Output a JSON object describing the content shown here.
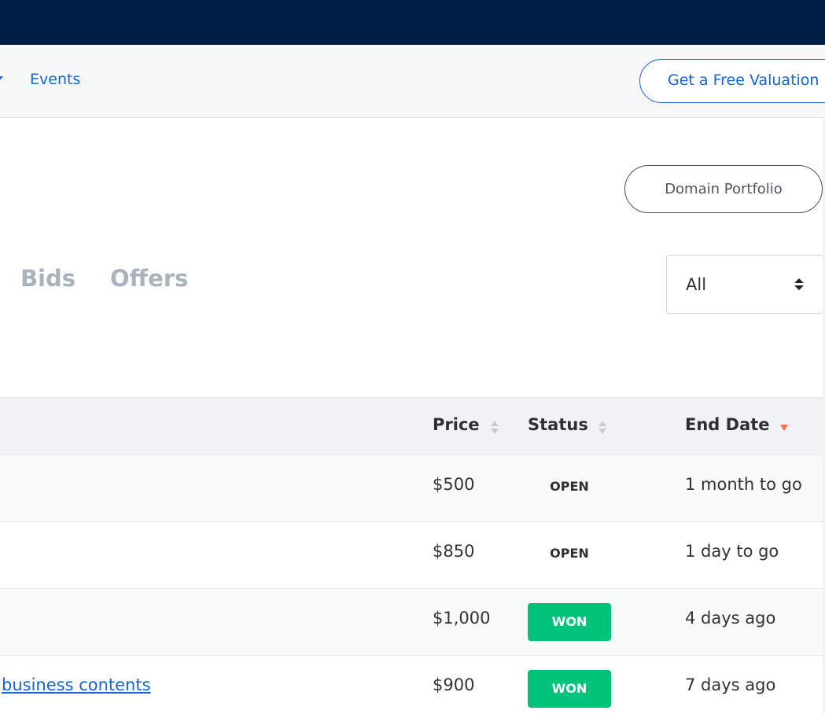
{
  "nav": {
    "events_label": "Events",
    "valuation_label": "Get a Free Valuation"
  },
  "page": {
    "portfolio_button": "Domain Portfolio"
  },
  "tabs": [
    {
      "label": "Bids"
    },
    {
      "label": "Offers"
    }
  ],
  "filter": {
    "selected": "All"
  },
  "table": {
    "columns": [
      {
        "label": "Price",
        "sort": "none"
      },
      {
        "label": "Status",
        "sort": "none"
      },
      {
        "label": "End Date",
        "sort": "desc"
      }
    ],
    "rows": [
      {
        "domain": "",
        "price": "$500",
        "status": "OPEN",
        "end": "1 month to go"
      },
      {
        "domain": "",
        "price": "$850",
        "status": "OPEN",
        "end": "1 day to go"
      },
      {
        "domain": "",
        "price": "$1,000",
        "status": "WON",
        "end": "4 days ago"
      },
      {
        "domain": "business contents",
        "price": "$900",
        "status": "WON",
        "end": "7 days ago"
      }
    ]
  },
  "colors": {
    "topbar": "#001e45",
    "accent": "#1466d8",
    "won": "#00c37a",
    "sort_active": "#f0744a"
  },
  "icons": {
    "nav_caret": "chevron-down-icon",
    "select_arrows": "sort-arrows-icon",
    "sort_inactive": "sort-icon",
    "sort_active": "sort-desc-icon"
  }
}
